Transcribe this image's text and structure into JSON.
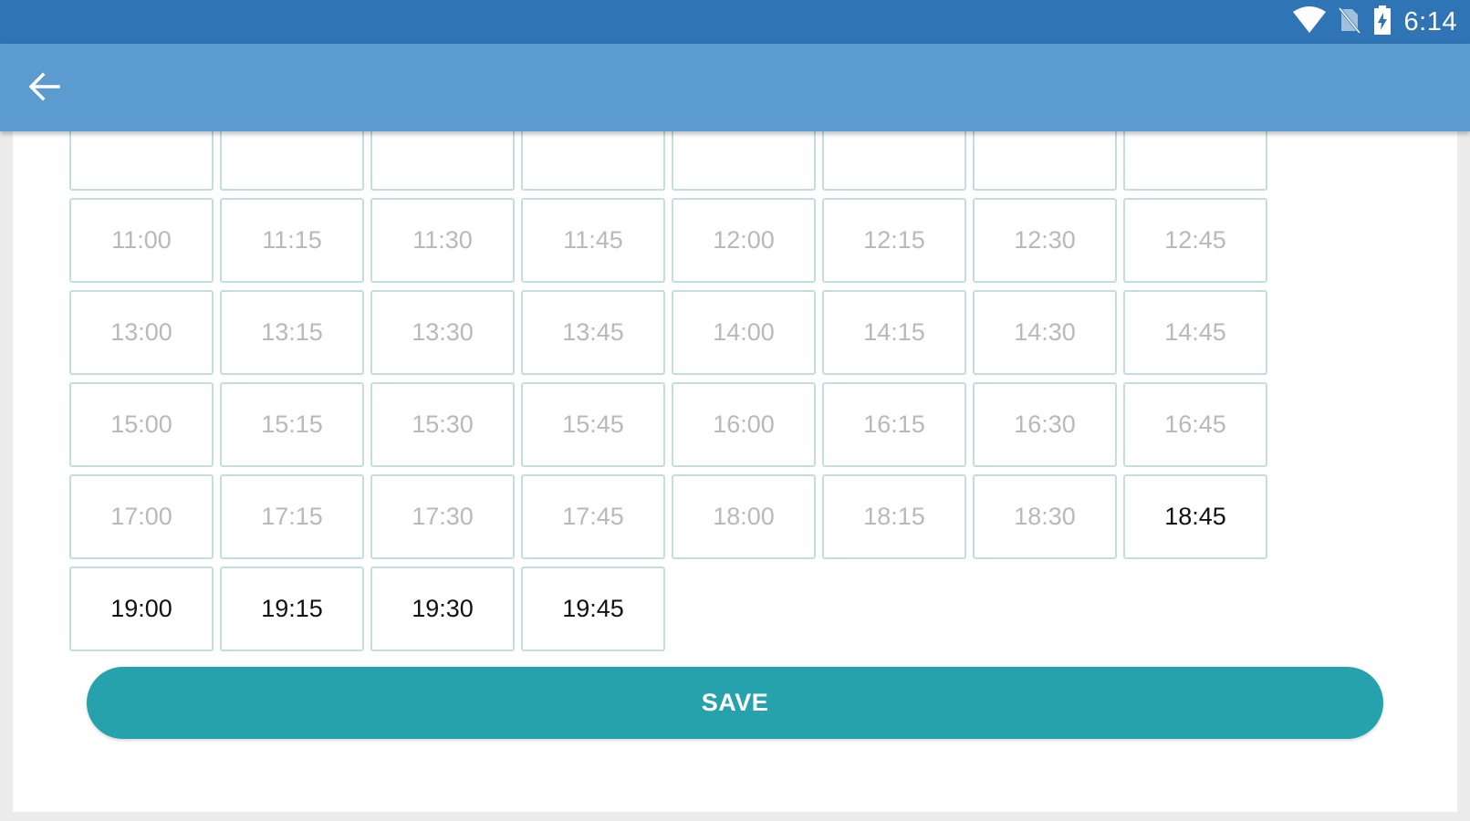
{
  "status_bar": {
    "time": "6:14",
    "icons": [
      "wifi-icon",
      "no-sim-icon",
      "battery-icon"
    ]
  },
  "app_bar": {
    "back_icon": "arrow-left-icon"
  },
  "time_slots": {
    "partial_row_count": 8,
    "rows": [
      [
        {
          "label": "11:00",
          "available": false
        },
        {
          "label": "11:15",
          "available": false
        },
        {
          "label": "11:30",
          "available": false
        },
        {
          "label": "11:45",
          "available": false
        },
        {
          "label": "12:00",
          "available": false
        },
        {
          "label": "12:15",
          "available": false
        },
        {
          "label": "12:30",
          "available": false
        },
        {
          "label": "12:45",
          "available": false
        }
      ],
      [
        {
          "label": "13:00",
          "available": false
        },
        {
          "label": "13:15",
          "available": false
        },
        {
          "label": "13:30",
          "available": false
        },
        {
          "label": "13:45",
          "available": false
        },
        {
          "label": "14:00",
          "available": false
        },
        {
          "label": "14:15",
          "available": false
        },
        {
          "label": "14:30",
          "available": false
        },
        {
          "label": "14:45",
          "available": false
        }
      ],
      [
        {
          "label": "15:00",
          "available": false
        },
        {
          "label": "15:15",
          "available": false
        },
        {
          "label": "15:30",
          "available": false
        },
        {
          "label": "15:45",
          "available": false
        },
        {
          "label": "16:00",
          "available": false
        },
        {
          "label": "16:15",
          "available": false
        },
        {
          "label": "16:30",
          "available": false
        },
        {
          "label": "16:45",
          "available": false
        }
      ],
      [
        {
          "label": "17:00",
          "available": false
        },
        {
          "label": "17:15",
          "available": false
        },
        {
          "label": "17:30",
          "available": false
        },
        {
          "label": "17:45",
          "available": false
        },
        {
          "label": "18:00",
          "available": false
        },
        {
          "label": "18:15",
          "available": false
        },
        {
          "label": "18:30",
          "available": false
        },
        {
          "label": "18:45",
          "available": true
        }
      ],
      [
        {
          "label": "19:00",
          "available": true
        },
        {
          "label": "19:15",
          "available": true
        },
        {
          "label": "19:30",
          "available": true
        },
        {
          "label": "19:45",
          "available": true
        }
      ]
    ]
  },
  "save_button": {
    "label": "SAVE"
  },
  "colors": {
    "status_bar": "#2f74b5",
    "app_bar": "#5b9bd0",
    "accent": "#26a2ad",
    "slot_border": "#c3dede",
    "slot_disabled_text": "#b9b9b9",
    "slot_available_text": "#111111"
  }
}
